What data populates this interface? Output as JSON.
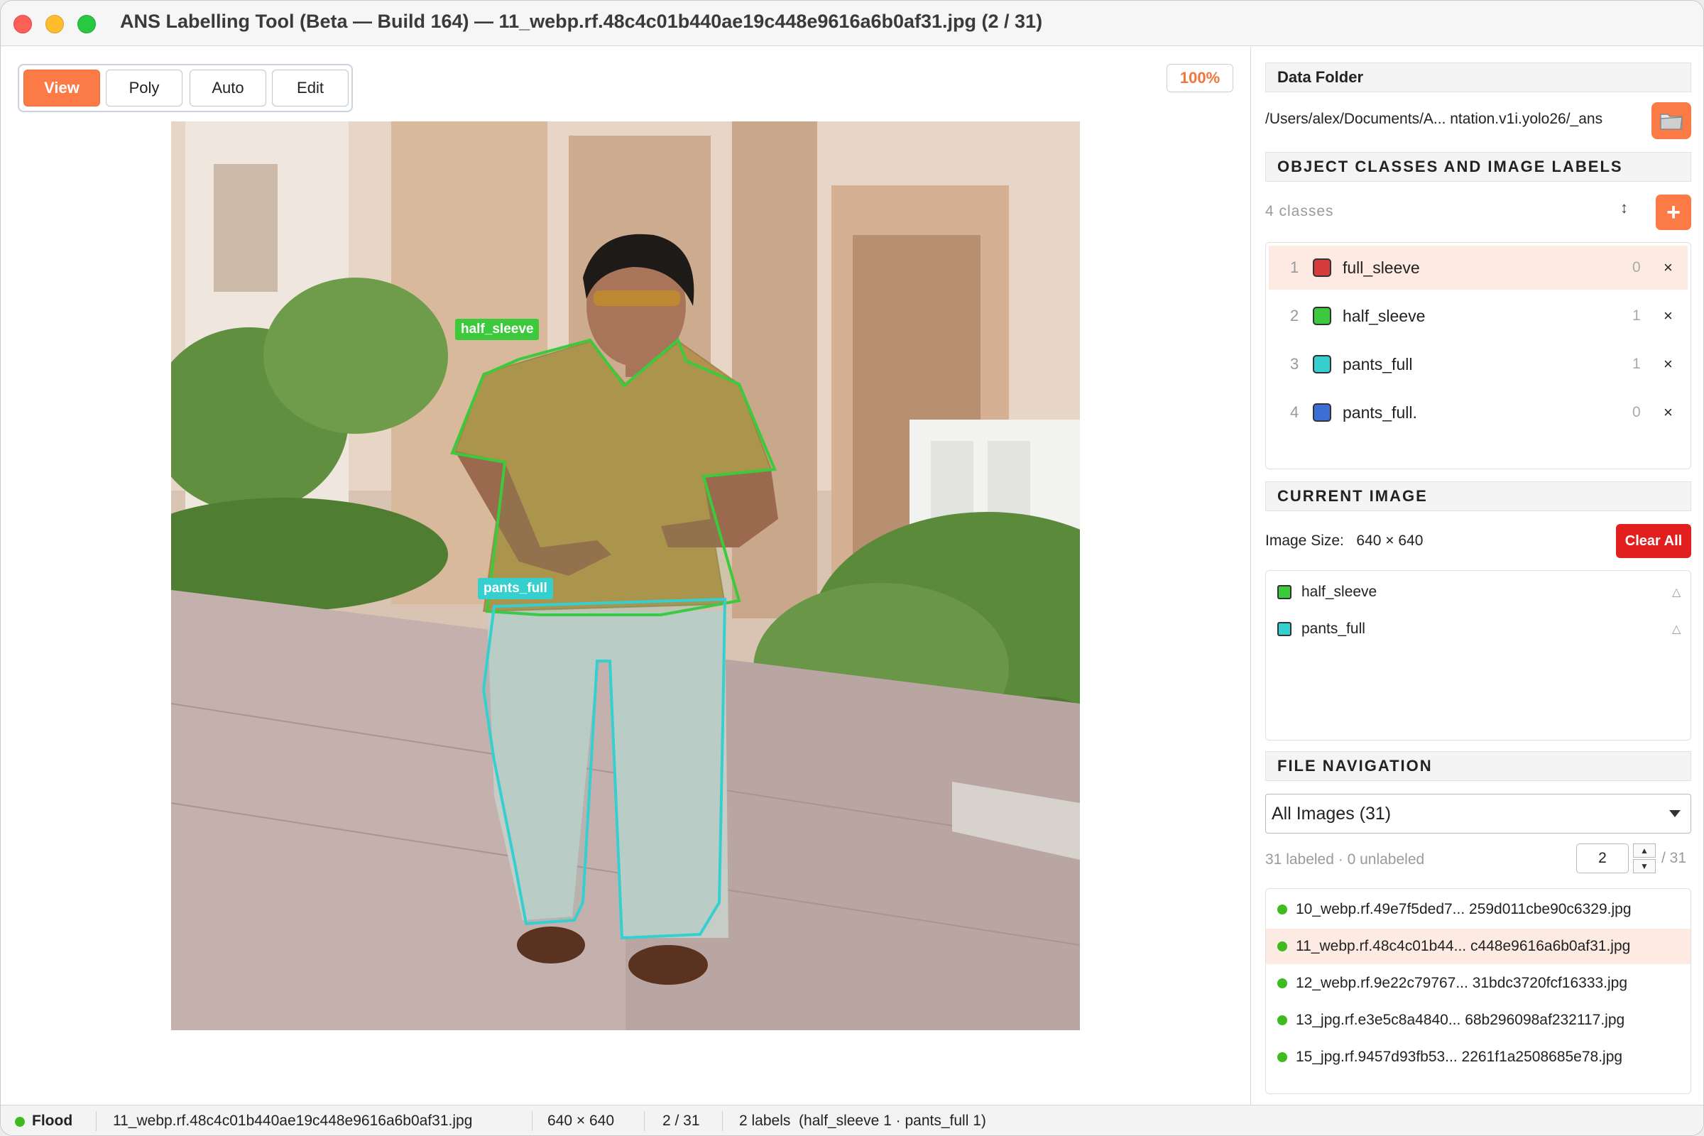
{
  "window": {
    "title": "ANS Labelling Tool (Beta — Build 164) — 11_webp.rf.48c4c01b440ae19c448e9616a6b0af31.jpg   (2 / 31)"
  },
  "toolbar": {
    "modes": [
      "View",
      "Poly",
      "Auto",
      "Edit"
    ],
    "active_mode": "View",
    "zoom": "100%"
  },
  "canvas": {
    "annotations": [
      {
        "label": "half_sleeve",
        "color": "#3cc93c"
      },
      {
        "label": "pants_full",
        "color": "#36cfcf"
      }
    ]
  },
  "panel": {
    "data_folder": {
      "heading": "Data Folder",
      "path": "/Users/alex/Documents/A... ntation.v1i.yolo26/_ans"
    },
    "classes": {
      "heading": "OBJECT CLASSES AND IMAGE LABELS",
      "count_text": "4 classes",
      "sort_icon": "↕",
      "add_label": "+",
      "items": [
        {
          "num": "1",
          "name": "full_sleeve",
          "count": "0",
          "color": "#d63c3c",
          "delete": "×"
        },
        {
          "num": "2",
          "name": "half_sleeve",
          "count": "1",
          "color": "#3cc93c",
          "delete": "×"
        },
        {
          "num": "3",
          "name": "pants_full",
          "count": "1",
          "color": "#36cfcf",
          "delete": "×"
        },
        {
          "num": "4",
          "name": "pants_full.",
          "count": "0",
          "color": "#3c6fd6",
          "delete": "×"
        }
      ]
    },
    "current_image": {
      "heading": "CURRENT IMAGE",
      "size_label": "Image Size:",
      "size_value": "640 × 640",
      "clear_all": "Clear All",
      "labels": [
        {
          "name": "half_sleeve",
          "color": "#3cc93c",
          "mark": "△"
        },
        {
          "name": "pants_full",
          "color": "#36cfcf",
          "mark": "△"
        }
      ]
    },
    "file_navigation": {
      "heading": "FILE NAVIGATION",
      "filter": "All Images (31)",
      "stats": "31 labeled · 0 unlabeled",
      "page": "2",
      "total": "/ 31",
      "stepper_up": "▲",
      "stepper_down": "▼",
      "files": [
        "10_webp.rf.49e7f5ded7... 259d011cbe90c6329.jpg",
        "11_webp.rf.48c4c01b44... c448e9616a6b0af31.jpg",
        "12_webp.rf.9e22c79767... 31bdc3720fcf16333.jpg",
        "13_jpg.rf.e3e5c8a4840... 68b296098af232117.jpg",
        "15_jpg.rf.9457d93fb53... 2261f1a2508685e78.jpg"
      ]
    }
  },
  "status": {
    "mode": "Flood",
    "file": "11_webp.rf.48c4c01b440ae19c448e9616a6b0af31.jpg",
    "size": "640 × 640",
    "position": "2 / 31",
    "labels": "2 labels  (half_sleeve 1 · pants_full 1)"
  }
}
